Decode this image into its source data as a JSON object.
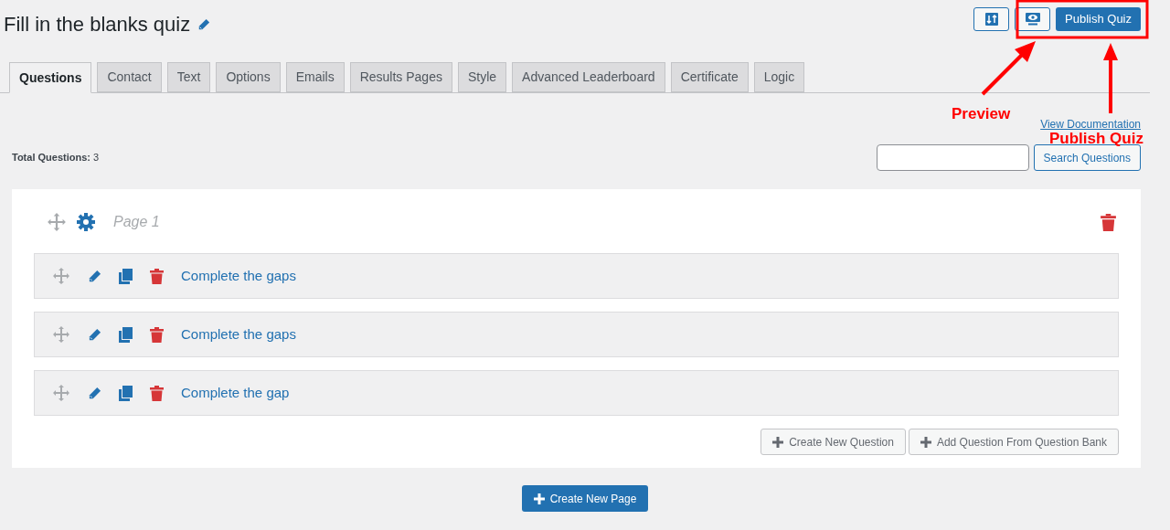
{
  "header": {
    "title": "Fill in the blanks quiz"
  },
  "toolbar": {
    "publish_button": "Publish Quiz"
  },
  "tabs": [
    {
      "label": "Questions",
      "selected": true
    },
    {
      "label": "Contact",
      "selected": false
    },
    {
      "label": "Text",
      "selected": false
    },
    {
      "label": "Options",
      "selected": false
    },
    {
      "label": "Emails",
      "selected": false
    },
    {
      "label": "Results Pages",
      "selected": false
    },
    {
      "label": "Style",
      "selected": false
    },
    {
      "label": "Advanced Leaderboard",
      "selected": false
    },
    {
      "label": "Certificate",
      "selected": false
    },
    {
      "label": "Logic",
      "selected": false
    }
  ],
  "documentation_link": "View Documentation",
  "total_questions": "**Total Questions:** 3",
  "search": {
    "button": "Search Questions"
  },
  "pages": [
    {
      "title": "Page 1",
      "questions": [
        {
          "title": "Complete the gaps"
        },
        {
          "title": "Complete the gaps"
        },
        {
          "title": "Complete the gap"
        }
      ]
    }
  ],
  "actions": [
    "Create New Question",
    "Add Question From Question Bank"
  ],
  "create_page_button": "Create New Page",
  "annotations": [
    {
      "text": "Preview"
    },
    {
      "text": "Publish Quiz"
    }
  ]
}
